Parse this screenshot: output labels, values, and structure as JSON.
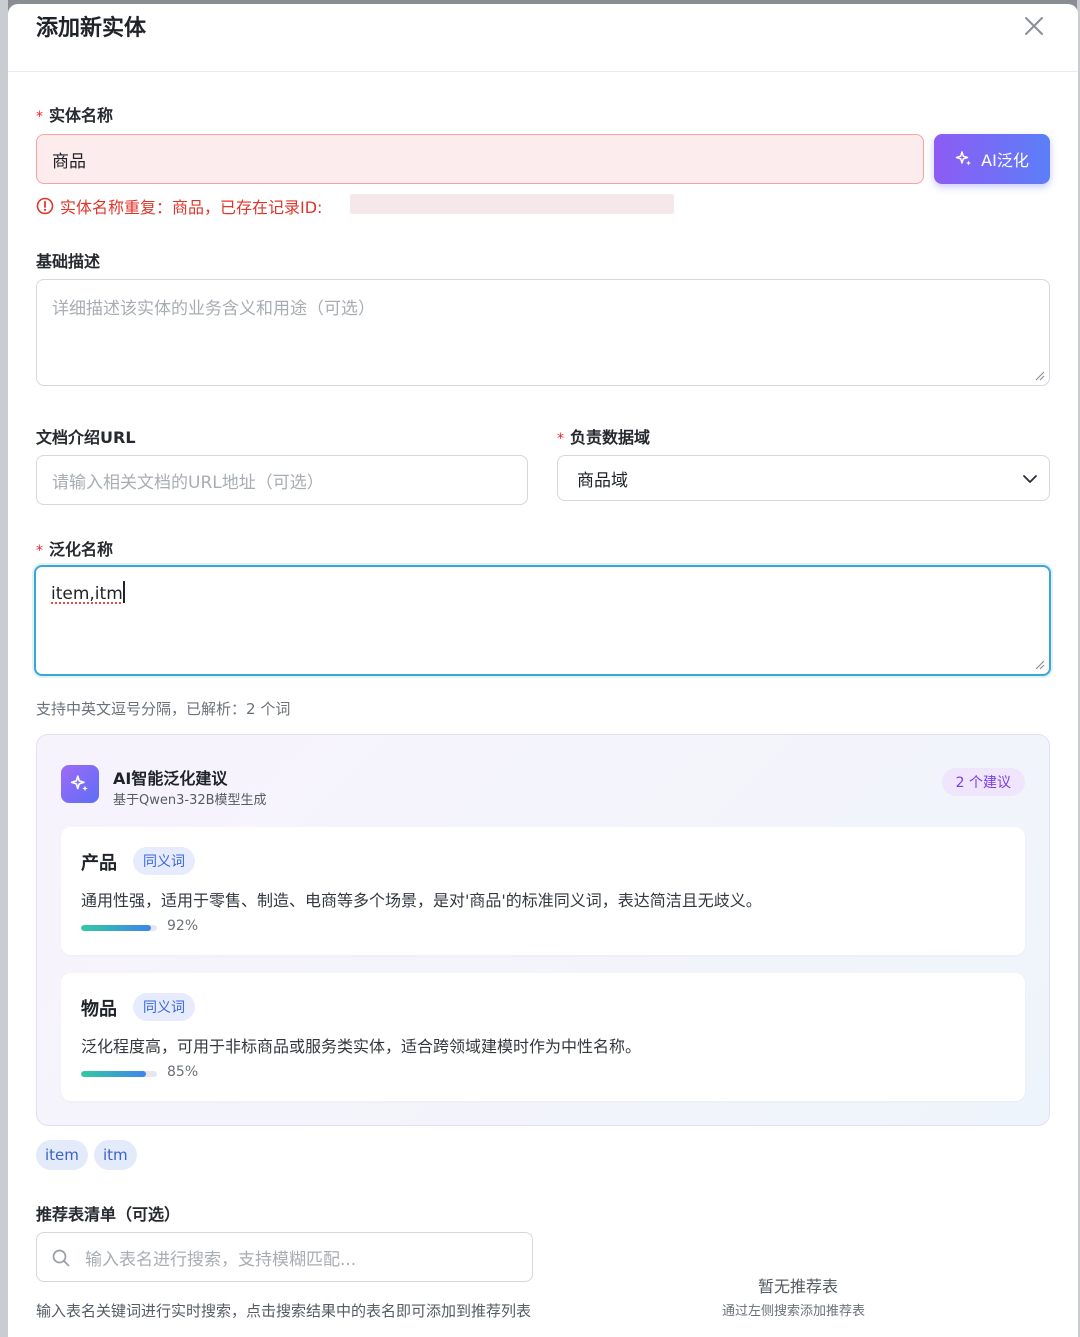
{
  "modal": {
    "title": "添加新实体"
  },
  "entity_name": {
    "label": "实体名称",
    "value": "商品",
    "error": "实体名称重复：商品，已存在记录ID:"
  },
  "ai_button": {
    "label": "AI泛化"
  },
  "description": {
    "label": "基础描述",
    "placeholder": "详细描述该实体的业务含义和用途（可选）"
  },
  "doc_url": {
    "label": "文档介绍URL",
    "placeholder": "请输入相关文档的URL地址（可选）"
  },
  "domain": {
    "label": "负责数据域",
    "selected": "商品域"
  },
  "generalized": {
    "label": "泛化名称",
    "value": "item,itm",
    "hint": "支持中英文逗号分隔，已解析：2 个词"
  },
  "ai_suggestions": {
    "title": "AI智能泛化建议",
    "subtitle": "基于Qwen3-32B模型生成",
    "count_badge": "2 个建议",
    "items": [
      {
        "word": "产品",
        "tag": "同义词",
        "desc": "通用性强，适用于零售、制造、电商等多个场景，是对'商品'的标准同义词，表达简洁且无歧义。",
        "confidence": 92,
        "confidence_label": "92%"
      },
      {
        "word": "物品",
        "tag": "同义词",
        "desc": "泛化程度高，可用于非标商品或服务类实体，适合跨领域建模时作为中性名称。",
        "confidence": 85,
        "confidence_label": "85%"
      }
    ]
  },
  "chips": [
    "item",
    "itm"
  ],
  "tables": {
    "label": "推荐表清单（可选）",
    "search_placeholder": "输入表名进行搜索，支持模糊匹配...",
    "hint": "输入表名关键词进行实时搜索，点击搜索结果中的表名即可添加到推荐列表",
    "empty_title": "暂无推荐表",
    "empty_sub": "通过左侧搜索添加推荐表"
  },
  "colors": {
    "accent_gradient_start": "#8e5bf5",
    "accent_gradient_end": "#5b7ff7",
    "error": "#e0352b",
    "focus": "#3aa6d6"
  }
}
